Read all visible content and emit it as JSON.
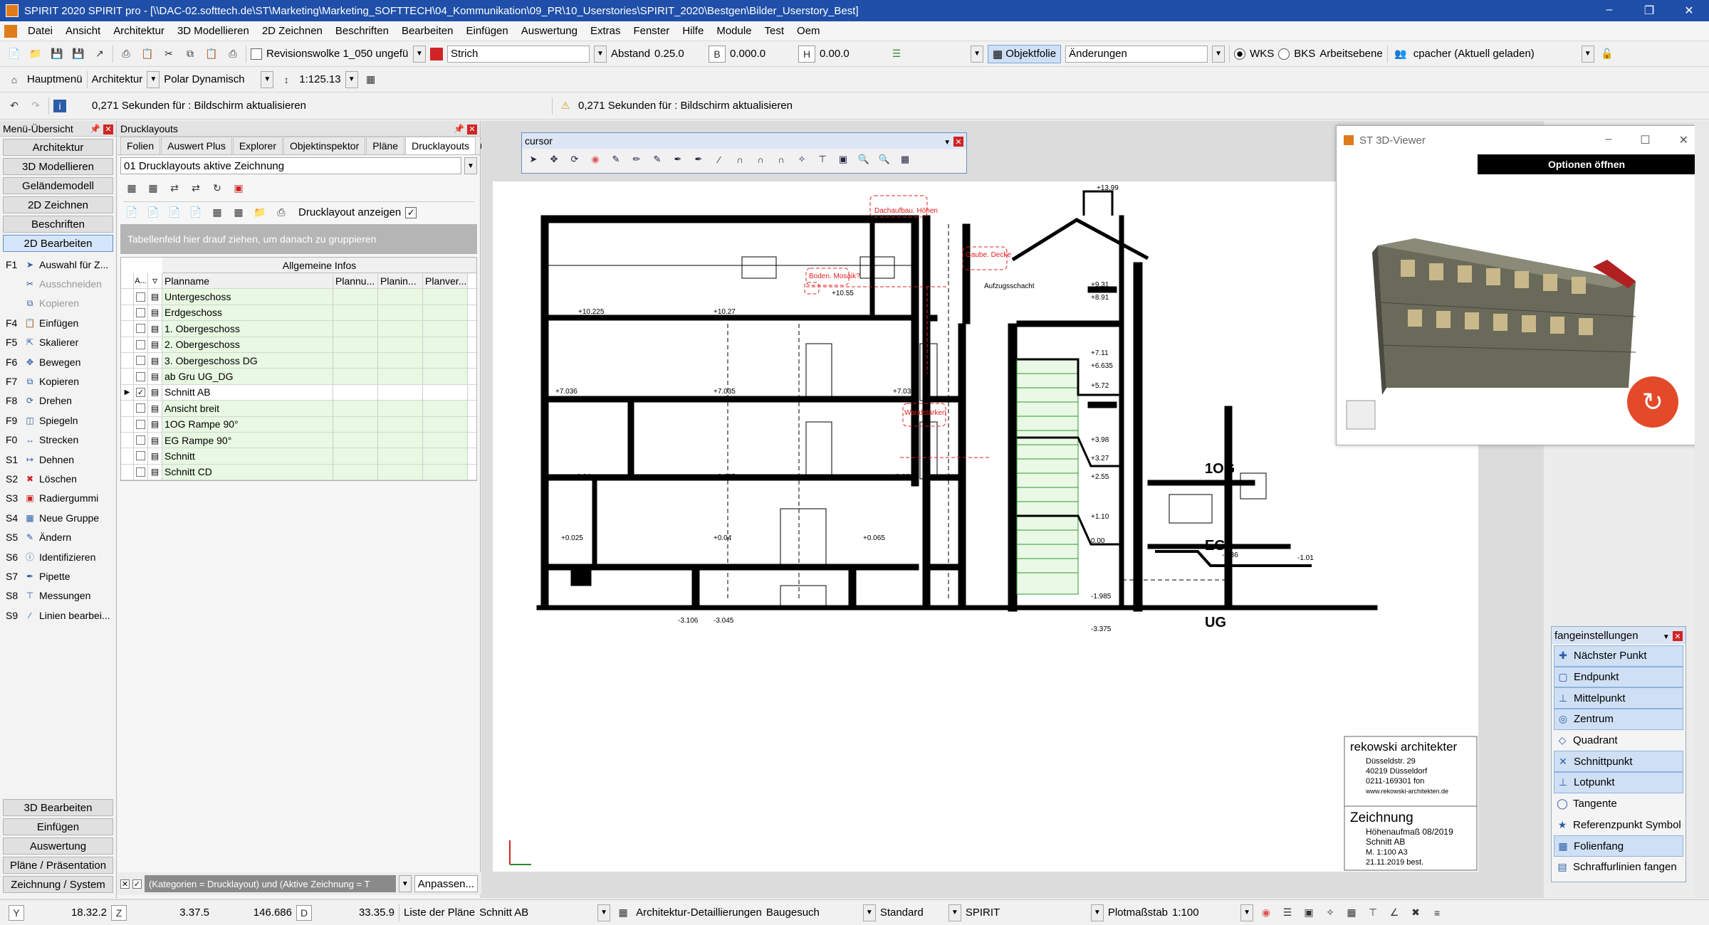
{
  "window": {
    "title": "SPIRIT 2020 SPIRIT pro - [\\\\DAC-02.softtech.de\\ST\\Marketing\\Marketing_SOFTTECH\\04_Kommunikation\\09_PR\\10_Userstories\\SPIRIT_2020\\Bestgen\\Bilder_Userstory_Best]"
  },
  "menu": [
    "Datei",
    "Ansicht",
    "Architektur",
    "3D Modellieren",
    "2D Zeichnen",
    "Beschriften",
    "Bearbeiten",
    "Einfügen",
    "Auswertung",
    "Extras",
    "Fenster",
    "Hilfe",
    "Module",
    "Test",
    "Oem"
  ],
  "toolbar1": {
    "revision": "Revisionswolke 1_050 ungefü",
    "strich": "Strich",
    "abstand_label": "Abstand",
    "abstand_value": "0.25.0",
    "b_value": "0.000.0",
    "h_value": "0.00.0",
    "objektfolie": "Objektfolie",
    "aenderungen": "Änderungen",
    "wks": "WKS",
    "bks": "BKS",
    "arbeitsebene": "Arbeitsebene",
    "user": "cpacher (Aktuell geladen)"
  },
  "toolbar2": {
    "hauptmenu": "Hauptmenü",
    "architektur": "Architektur",
    "polar": "Polar Dynamisch",
    "scale": "1:125.13"
  },
  "toolbar3": {
    "msg1": "0,271 Sekunden für : Bildschirm aktualisieren",
    "msg2": "0,271 Sekunden für : Bildschirm aktualisieren"
  },
  "left_panel": {
    "title": "Menü-Übersicht",
    "categories_top": [
      "Architektur",
      "3D Modellieren",
      "Geländemodell",
      "2D Zeichnen",
      "Beschriften",
      "2D Bearbeiten"
    ],
    "fkeys": [
      {
        "k": "F1",
        "label": "Auswahl für Z...",
        "icon": "select-icon",
        "dis": false
      },
      {
        "k": "",
        "label": "Ausschneiden",
        "icon": "cut-icon",
        "dis": true
      },
      {
        "k": "",
        "label": "Kopieren",
        "icon": "copy-icon",
        "dis": true
      },
      {
        "k": "F4",
        "label": "Einfügen",
        "icon": "paste-icon",
        "dis": false
      },
      {
        "k": "F5",
        "label": "Skalierer",
        "icon": "scale-icon",
        "dis": false
      },
      {
        "k": "F6",
        "label": "Bewegen",
        "icon": "move-icon",
        "dis": false
      },
      {
        "k": "F7",
        "label": "Kopieren",
        "icon": "copy-icon",
        "dis": false
      },
      {
        "k": "F8",
        "label": "Drehen",
        "icon": "rotate-icon",
        "dis": false
      },
      {
        "k": "F9",
        "label": "Spiegeln",
        "icon": "mirror-icon",
        "dis": false
      },
      {
        "k": "F0",
        "label": "Strecken",
        "icon": "stretch-icon",
        "dis": false
      },
      {
        "k": "S1",
        "label": "Dehnen",
        "icon": "extend-icon",
        "dis": false
      },
      {
        "k": "S2",
        "label": "Löschen",
        "icon": "delete-icon",
        "dis": false
      },
      {
        "k": "S3",
        "label": "Radiergummi",
        "icon": "eraser-icon",
        "dis": false
      },
      {
        "k": "S4",
        "label": "Neue Gruppe",
        "icon": "group-icon",
        "dis": false
      },
      {
        "k": "S5",
        "label": "Ändern",
        "icon": "edit-icon",
        "dis": false
      },
      {
        "k": "S6",
        "label": "Identifizieren",
        "icon": "identify-icon",
        "dis": false
      },
      {
        "k": "S7",
        "label": "Pipette",
        "icon": "pipette-icon",
        "dis": false
      },
      {
        "k": "S8",
        "label": "Messungen",
        "icon": "measure-icon",
        "dis": false
      },
      {
        "k": "S9",
        "label": "Linien bearbei...",
        "icon": "line-edit-icon",
        "dis": false
      }
    ],
    "categories_bottom": [
      "3D Bearbeiten",
      "Einfügen",
      "Auswertung",
      "Pläne / Präsentation",
      "Zeichnung / System"
    ]
  },
  "drucklayouts": {
    "title": "Drucklayouts",
    "tabs": [
      "Folien",
      "Auswert Plus",
      "Explorer",
      "Objektinspektor",
      "Pläne",
      "Drucklayouts"
    ],
    "dropdown": "01 Drucklayouts aktive Zeichnung",
    "show_label": "Drucklayout anzeigen",
    "group_hint": "Tabellenfeld hier drauf ziehen, um danach zu gruppieren",
    "group_header": "Allgemeine Infos",
    "columns": [
      "A...",
      "Planname",
      "Plannu...",
      "Planin...",
      "Planver..."
    ],
    "rows": [
      "Untergeschoss",
      "Erdgeschoss",
      "1. Obergeschoss",
      "2. Obergeschoss",
      "3. Obergeschoss DG",
      "ab Gru UG_DG",
      "Schnitt AB",
      "Ansicht breit",
      "1OG Rampe 90°",
      "EG Rampe 90°",
      "Schnitt",
      "Schnitt CD"
    ],
    "active_row": 6,
    "filter": "(Kategorien = Drucklayout) und (Aktive Zeichnung = T",
    "anpassen": "Anpassen..."
  },
  "cursor_toolbar": {
    "title": "cursor"
  },
  "drawing": {
    "labels": [
      "Dachaufbau. Höhen",
      "Gaube. Decke",
      "Boden. Mosaik?",
      "Aufzugsschacht",
      "Wandstärken",
      "+13.99",
      "+10.225",
      "+10.27",
      "+10.55",
      "+9.31",
      "+8.91",
      "+7.036",
      "+7.035",
      "+7.035",
      "+7.11",
      "+6.635",
      "+5.72",
      "+3.64",
      "+3.635",
      "+3.66",
      "+3.98",
      "+3.27",
      "+2.55",
      "+1.10",
      "+0.025",
      "+0.04",
      "+0.065",
      "0.00",
      "-0.86",
      "-1.01",
      "-1.985",
      "-3.106",
      "-3.045",
      "-3.375",
      "1OG",
      "EG",
      "UG"
    ],
    "title_block": {
      "firm": "rekowski architekter",
      "addr1": "Düsseldstr. 29",
      "addr2": "40219 Düsseldorf",
      "phone": "0211-169301 fon",
      "web": "www.rekowski-architekten.de",
      "heading": "Zeichnung",
      "line1": "Höhenaufmaß 08/2019",
      "line2": "Schnitt AB",
      "line3": "M. 1:100 A3",
      "line4": "21.11.2019 best."
    }
  },
  "viewer": {
    "title": "ST 3D-Viewer",
    "options": "Optionen öffnen"
  },
  "fang": {
    "title": "fangeinstellungen",
    "items": [
      {
        "label": "Nächster Punkt",
        "on": true
      },
      {
        "label": "Endpunkt",
        "on": true
      },
      {
        "label": "Mittelpunkt",
        "on": true
      },
      {
        "label": "Zentrum",
        "on": true
      },
      {
        "label": "Quadrant",
        "on": false
      },
      {
        "label": "Schnittpunkt",
        "on": true
      },
      {
        "label": "Lotpunkt",
        "on": true
      },
      {
        "label": "Tangente",
        "on": false
      },
      {
        "label": "Referenzpunkt Symbol",
        "on": false
      },
      {
        "label": "Folienfang",
        "on": true
      },
      {
        "label": "Schraffurlinien fangen",
        "on": false
      }
    ]
  },
  "status": {
    "y_label": "Y",
    "y": "18.32.2",
    "z_label": "Z",
    "z": "3.37.5",
    "x": "146.686",
    "d_label": "D",
    "d": "33.35.9",
    "plaene_label": "Liste der Pläne",
    "plan": "Schnitt AB",
    "detail": "Architektur-Detaillierungen",
    "baugesuch": "Baugesuch",
    "standard": "Standard",
    "spirit": "SPIRIT",
    "plotlabel": "Plotmaßstab",
    "plot": "1:100"
  },
  "colors": {
    "titlebar": "#1f4fa8",
    "accent": "#d02424",
    "green_rows": "#e8f8e2"
  }
}
